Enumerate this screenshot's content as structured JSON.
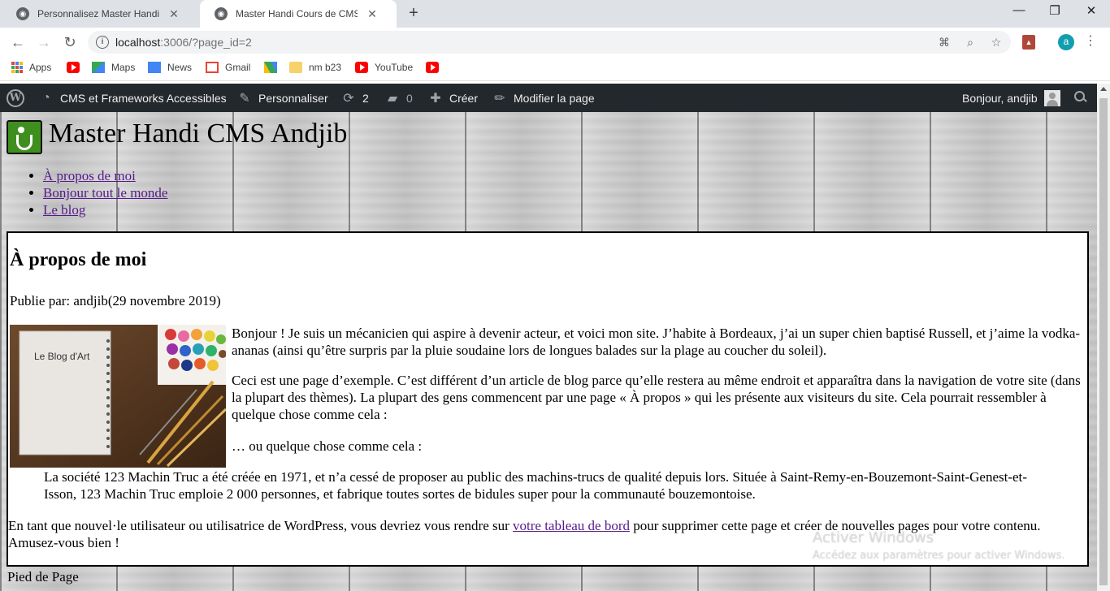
{
  "browser": {
    "tabs": [
      {
        "title": "Personnalisez Master Handi Cours de CMS",
        "active": false
      },
      {
        "title": "Master Handi Cours de CMS",
        "active": true
      }
    ],
    "new_tab": "+",
    "window_controls": {
      "minimize": "—",
      "maximize": "❐",
      "close": "✕"
    },
    "url_host": "localhost",
    "url_rest": ":3006/?page_id=2",
    "profile_initial": "a",
    "bookmarks": [
      {
        "label": "Apps",
        "icon": "apps-grid-icon"
      },
      {
        "label": "",
        "icon": "youtube-icon"
      },
      {
        "label": "Maps",
        "icon": "maps-icon"
      },
      {
        "label": "News",
        "icon": "news-icon"
      },
      {
        "label": "Gmail",
        "icon": "gmail-icon"
      },
      {
        "label": "",
        "icon": "drive-icon"
      },
      {
        "label": "nm b23",
        "icon": "folder-icon"
      },
      {
        "label": "YouTube",
        "icon": "youtube-icon"
      },
      {
        "label": "",
        "icon": "youtube-icon"
      }
    ]
  },
  "adminbar": {
    "site_name": "CMS et Frameworks Accessibles",
    "customize": "Personnaliser",
    "updates_count": "2",
    "comments_count": "0",
    "create": "Créer",
    "edit_page": "Modifier la page",
    "greeting": "Bonjour, andjib"
  },
  "site": {
    "title": "Master Handi CMS Andjib",
    "nav": [
      "À propos de moi",
      "Bonjour tout le monde",
      "Le blog"
    ]
  },
  "article": {
    "title": "À propos de moi",
    "meta": "Publie par: andjib(29 novembre 2019)",
    "image_label": "Le Blog d'Art",
    "p1": "Bonjour ! Je suis un mécanicien qui aspire à devenir acteur, et voici mon site. J’habite à Bordeaux, j’ai un super chien baptisé Russell, et j’aime la vodka-ananas (ainsi qu’être surpris par la pluie soudaine lors de longues balades sur la plage au coucher du soleil).",
    "p2": "Ceci est une page d’exemple. C’est différent d’un article de blog parce qu’elle restera au même endroit et apparaîtra dans la navigation de votre site (dans la plupart des thèmes). La plupart des gens commencent par une page « À propos » qui les présente aux visiteurs du site. Cela pourrait ressembler à quelque chose comme cela :",
    "p3": "… ou quelque chose comme cela :",
    "quote": "La société 123 Machin Truc a été créée en 1971, et n’a cessé de proposer au public des machins-trucs de qualité depuis lors. Située à Saint-Remy-en-Bouzemont-Saint-Genest-et-Isson, 123 Machin Truc emploie 2 000 personnes, et fabrique toutes sortes de bidules super pour la communauté bouzemontoise.",
    "p4_before": "En tant que nouvel·le utilisateur ou utilisatrice de WordPress, vous devriez vous rendre sur ",
    "p4_link": "votre tableau de bord",
    "p4_after": " pour supprimer cette page et créer de nouvelles pages pour votre contenu. Amusez-vous bien !"
  },
  "footer": "Pied de Page",
  "watermark": {
    "title": "Activer Windows",
    "subtitle": "Accédez aux paramètres pour activer Windows."
  }
}
